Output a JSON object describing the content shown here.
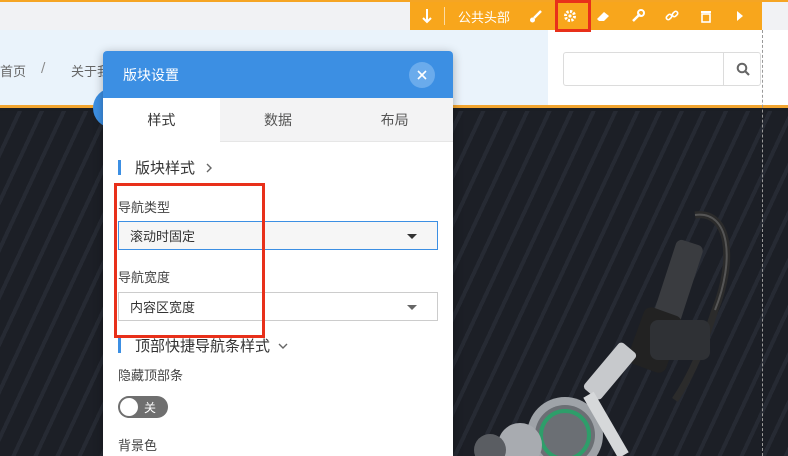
{
  "page": {
    "breadcrumb": {
      "home": "首页",
      "separator": "/",
      "about": "关于我"
    }
  },
  "toolbar": {
    "public_header_label": "公共头部",
    "icons": [
      "download-icon",
      "brush-icon",
      "gear-icon",
      "eraser-icon",
      "wrench-icon",
      "unlink-icon",
      "trash-icon",
      "play-icon"
    ],
    "accent_color": "#f8a61c",
    "active_item": "gear-icon"
  },
  "search": {
    "placeholder": ""
  },
  "dialog": {
    "title": "版块设置",
    "tabs": [
      {
        "label": "样式",
        "active": true
      },
      {
        "label": "数据",
        "active": false
      },
      {
        "label": "布局",
        "active": false
      }
    ],
    "section_block_style": "版块样式",
    "nav_type": {
      "label": "导航类型",
      "value": "滚动时固定"
    },
    "nav_width": {
      "label": "导航宽度",
      "value": "内容区宽度"
    },
    "section_topbar": "顶部快捷导航条样式",
    "hide_topbar": {
      "label": "隐藏顶部条",
      "toggle_text": "关",
      "on": false
    },
    "bg_color_label": "背景色",
    "header_color": "#3c8fe3"
  }
}
